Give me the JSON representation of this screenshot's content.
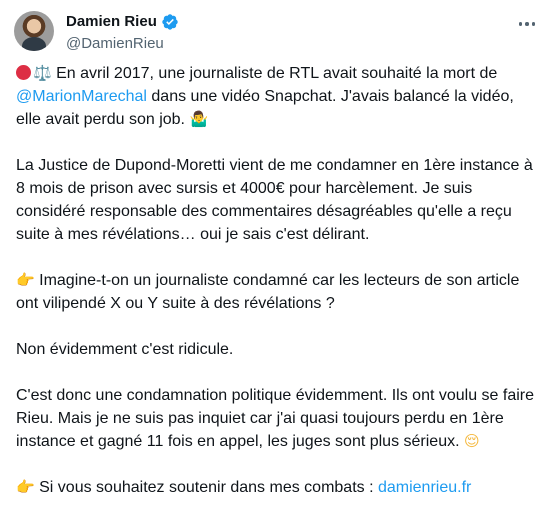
{
  "author": {
    "display_name": "Damien Rieu",
    "handle": "@DamienRieu",
    "verified": true
  },
  "tweet": {
    "p1": {
      "emoji_scale": "⚖️",
      "text_a": " En avril 2017, une journaliste de RTL avait souhaité la mort de ",
      "mention": "@MarionMarechal",
      "text_b": " dans une vidéo Snapchat. J'avais balancé la vidéo, elle avait perdu son job. ",
      "emoji_end": "🤷‍♂️"
    },
    "p2": "La Justice de Dupond-Moretti vient de me condamner en 1ère instance à 8 mois de prison avec sursis et 4000€ pour harcèlement. Je suis considéré responsable des commentaires désagréables qu'elle a reçu suite à mes révélations… oui je sais c'est délirant.",
    "p3": {
      "emoji": "👉",
      "text": " Imagine-t-on un journaliste condamné car les lecteurs de son article ont vilipendé X ou Y suite à des révélations ?"
    },
    "p4": "Non évidemment c'est ridicule.",
    "p5": {
      "text": "C'est donc une condamnation politique évidemment. Ils ont voulu se faire Rieu. Mais je ne suis pas inquiet car j'ai quasi toujours perdu en 1ère instance et gagné 11 fois en appel, les juges sont plus sérieux. ",
      "emoji": "😌"
    },
    "p6": {
      "emoji": "👉",
      "text": " Si vous souhaitez soutenir dans mes combats : ",
      "link": "damienrieu.fr"
    }
  },
  "colors": {
    "text": "#0f1419",
    "secondary": "#536471",
    "link": "#1d9bf0",
    "verified": "#1d9bf0"
  },
  "icons": {
    "verified": "verified-badge-icon",
    "more": "more-options-icon"
  }
}
